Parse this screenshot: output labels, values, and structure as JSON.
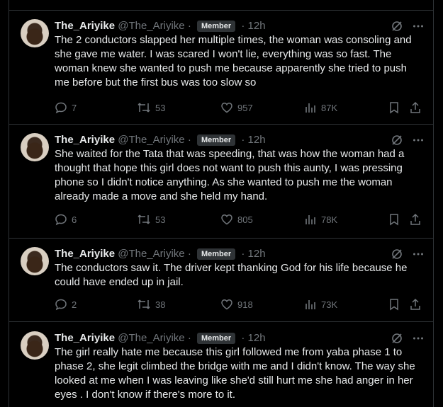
{
  "tweets": [
    {
      "name": "The_Ariyike",
      "handle": "@The_Ariyike",
      "badge": "Member",
      "time": "12h",
      "text": "The 2 conductors slapped her multiple times, the woman was consoling and she gave me water. I was scared I won't lie, everything was so fast. The woman knew she wanted to push me because apparently she tried to push me before but the first bus was too slow so",
      "replies": "7",
      "reposts": "53",
      "likes": "957",
      "views": "87K"
    },
    {
      "name": "The_Ariyike",
      "handle": "@The_Ariyike",
      "badge": "Member",
      "time": "12h",
      "text": "She waited for the Tata that was speeding, that was how the woman had a thought that hope this girl does not want to push this aunty, I was pressing phone so I didn't notice anything. As she wanted to push me the woman already made a move and she held my hand.",
      "replies": "6",
      "reposts": "53",
      "likes": "805",
      "views": "78K"
    },
    {
      "name": "The_Ariyike",
      "handle": "@The_Ariyike",
      "badge": "Member",
      "time": "12h",
      "text": "The conductors saw it. The driver kept thanking God for his life because he could have ended up in jail.",
      "replies": "2",
      "reposts": "38",
      "likes": "918",
      "views": "73K"
    },
    {
      "name": "The_Ariyike",
      "handle": "@The_Ariyike",
      "badge": "Member",
      "time": "12h",
      "text": "The girl really hate me because this girl followed me from yaba phase 1 to phase 2, she legit climbed the bridge with me and I didn't know. The way she looked at me when I was leaving like she'd still hurt me she had anger in her eyes . I don't know if there's more to it.",
      "replies": "",
      "reposts": "",
      "likes": "",
      "views": ""
    }
  ],
  "separator": "·",
  "icons": {
    "reply": "reply-icon",
    "repost": "repost-icon",
    "like": "heart-icon",
    "views": "views-icon",
    "bookmark": "bookmark-icon",
    "share": "share-icon",
    "grok": "grok-icon",
    "more": "more-icon"
  },
  "colors": {
    "background": "#000000",
    "text": "#e7e9ea",
    "muted": "#71767b",
    "border": "#2f3336"
  }
}
